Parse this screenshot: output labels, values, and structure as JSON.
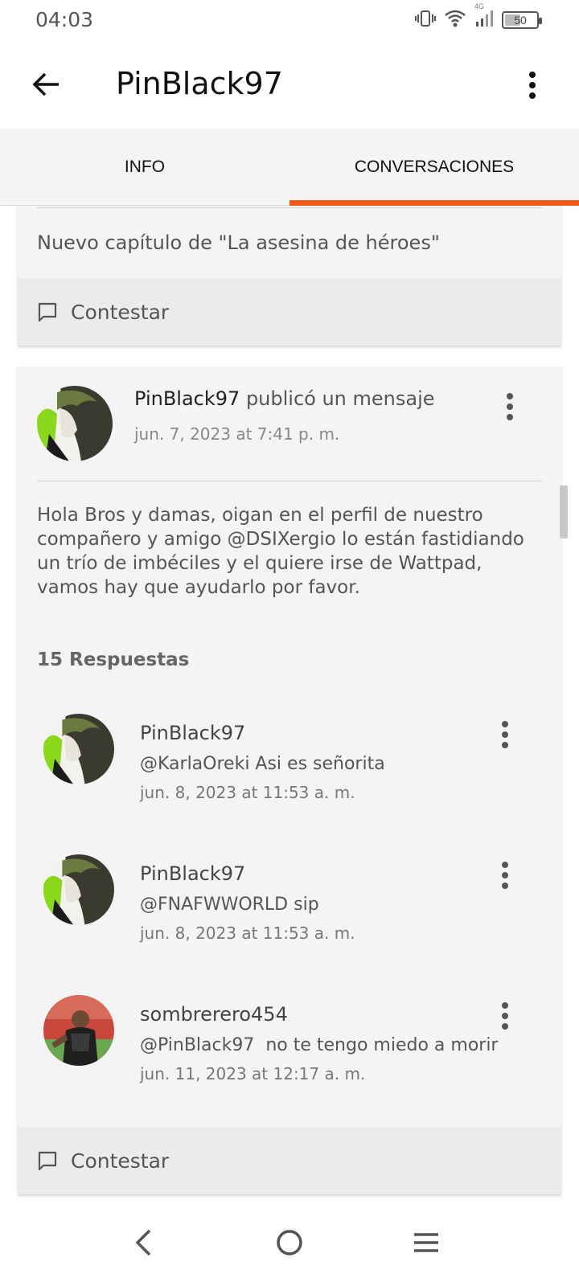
{
  "status_bar": {
    "time": "04:03",
    "battery": "50",
    "battery_level": 0.5,
    "network": "4G"
  },
  "app_bar": {
    "title": "PinBlack97"
  },
  "tabs": [
    {
      "label": "INFO",
      "active": false
    },
    {
      "label": "CONVERSACIONES",
      "active": true
    }
  ],
  "accent_color": "#f05a1a",
  "card1": {
    "message": "Nuevo capítulo de \"La asesina de héroes\"",
    "reply_label": "Contestar"
  },
  "post": {
    "author": "PinBlack97",
    "action": "publicó un mensaje",
    "date": "jun. 7, 2023 at 7:41 p. m.",
    "body": "Hola Bros y damas, oigan en el perfil de nuestro compañero y amigo @DSIXergio lo están fastidiando un trío de imbéciles y el quiere irse de Wattpad, vamos hay que ayudarlo por favor.",
    "replies_count": "15 Respuestas",
    "replies": [
      {
        "name": "PinBlack97",
        "text": "@KarlaOreki Asi es señorita",
        "date": "jun. 8, 2023 at 11:53 a. m."
      },
      {
        "name": "PinBlack97",
        "text": "@FNAFWWORLD sip",
        "date": "jun. 8, 2023 at 11:53 a. m."
      },
      {
        "name": "sombrerero454",
        "text": "@PinBlack97  no te tengo miedo a morir",
        "date": "jun. 11, 2023 at 12:17 a. m."
      }
    ],
    "reply_label": "Contestar"
  }
}
